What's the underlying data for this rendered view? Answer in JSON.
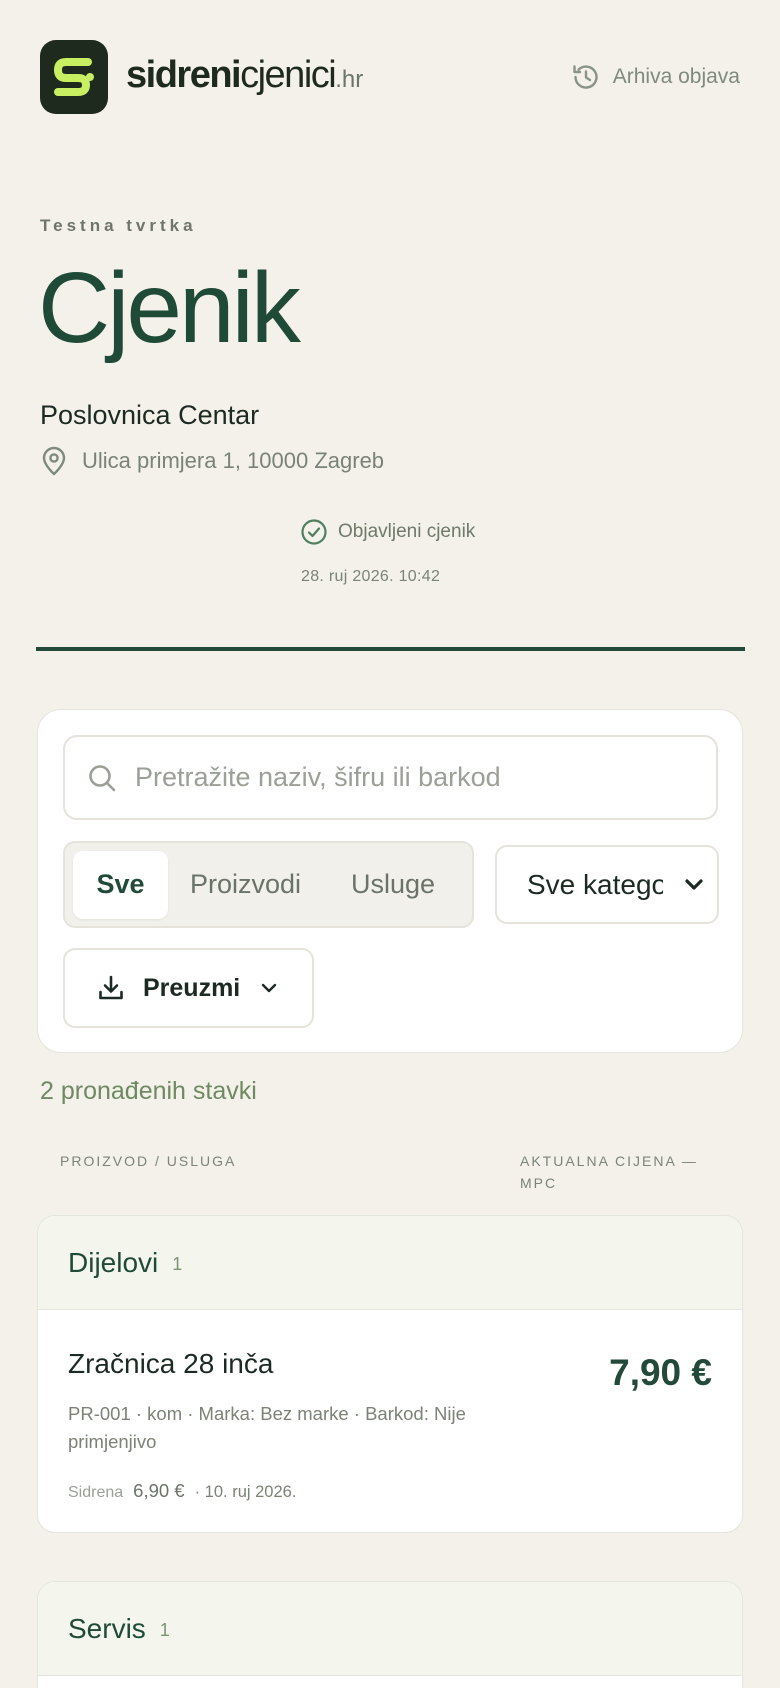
{
  "header": {
    "brand_bold": "sidreni",
    "brand_regular": "cjenici",
    "brand_tld": ".hr",
    "archive_label": "Arhiva objava",
    "logo_letter": "S"
  },
  "company": "Testna tvrtka",
  "title": "Cjenik",
  "branch": "Poslovnica Centar",
  "address": "Ulica primjera 1, 10000 Zagreb",
  "status": {
    "label": "Objavljeni cjenik",
    "date": "28. ruj 2026. 10:42"
  },
  "filters": {
    "search_placeholder": "Pretražite naziv, šifru ili barkod",
    "search_value": "",
    "segments": [
      "Sve",
      "Proizvodi",
      "Usluge"
    ],
    "active_segment": "Sve",
    "category_value": "Sve kategorije",
    "download_label": "Preuzmi"
  },
  "results_count": "2 pronađenih stavki",
  "columns": {
    "product": "PROIZVOD / USLUGA",
    "price": "AKTUALNA CIJENA — MPC"
  },
  "groups": [
    {
      "name": "Dijelovi",
      "count": "1",
      "items": [
        {
          "name": "Zračnica 28 inča",
          "meta": "PR-001 · kom · Marka: Bez marke · Barkod: Nije primjenjivo",
          "price": "7,90 €",
          "anchor_label": "Sidrena",
          "anchor_price": "6,90 €",
          "anchor_date": "· 10. ruj 2026."
        }
      ]
    },
    {
      "name": "Servis",
      "count": "1",
      "items": []
    }
  ],
  "colors": {
    "background": "#f3f1e9",
    "accent": "#204a38",
    "logo_bg": "#1f2a1f",
    "logo_fg": "#c8ee62",
    "muted": "#7a8376"
  },
  "icons": {
    "logo": "logo-s-icon",
    "archive": "history-icon",
    "address": "map-pin-icon",
    "status": "check-circle-icon",
    "search": "search-icon",
    "category": "chevron-down-icon",
    "download": "download-icon",
    "download_menu": "chevron-down-icon"
  }
}
